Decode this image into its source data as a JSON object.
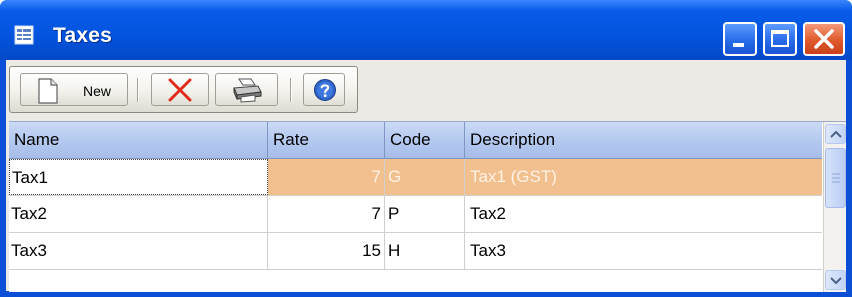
{
  "window": {
    "title": "Taxes",
    "icons": {
      "app": "list-window-icon",
      "minimize": "minimize-icon",
      "maximize": "maximize-icon",
      "close": "close-icon"
    }
  },
  "toolbar": {
    "new_label": "New",
    "icons": {
      "new": "new-document-icon",
      "delete": "delete-x-icon",
      "print": "printer-icon",
      "help": "help-question-icon"
    }
  },
  "grid": {
    "columns": [
      "Name",
      "Rate",
      "Code",
      "Description"
    ],
    "rows": [
      {
        "name": "Tax1",
        "rate": "7",
        "code": "G",
        "description": "Tax1 (GST)",
        "selected": true
      },
      {
        "name": "Tax2",
        "rate": "7",
        "code": "P",
        "description": "Tax2",
        "selected": false
      },
      {
        "name": "Tax3",
        "rate": "15",
        "code": "H",
        "description": "Tax3",
        "selected": false
      }
    ]
  },
  "colors": {
    "title_bar": "#0355e0",
    "selection": "#f2c08f",
    "header": "#b3c8ef",
    "close_button": "#e05a2c"
  }
}
